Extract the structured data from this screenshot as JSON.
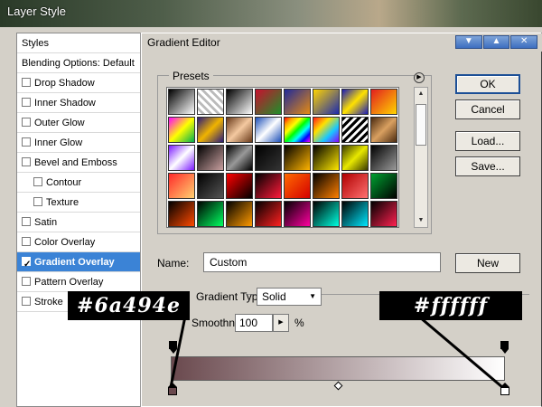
{
  "layer_style": {
    "title": "Layer Style",
    "styles_header": "Styles",
    "blending": "Blending Options: Default",
    "items": [
      {
        "label": "Drop Shadow",
        "checked": false,
        "indent": false,
        "selected": false
      },
      {
        "label": "Inner Shadow",
        "checked": false,
        "indent": false,
        "selected": false
      },
      {
        "label": "Outer Glow",
        "checked": false,
        "indent": false,
        "selected": false
      },
      {
        "label": "Inner Glow",
        "checked": false,
        "indent": false,
        "selected": false
      },
      {
        "label": "Bevel and Emboss",
        "checked": false,
        "indent": false,
        "selected": false
      },
      {
        "label": "Contour",
        "checked": false,
        "indent": true,
        "selected": false
      },
      {
        "label": "Texture",
        "checked": false,
        "indent": true,
        "selected": false
      },
      {
        "label": "Satin",
        "checked": false,
        "indent": false,
        "selected": false
      },
      {
        "label": "Color Overlay",
        "checked": false,
        "indent": false,
        "selected": false
      },
      {
        "label": "Gradient Overlay",
        "checked": true,
        "indent": false,
        "selected": true
      },
      {
        "label": "Pattern Overlay",
        "checked": false,
        "indent": false,
        "selected": false
      },
      {
        "label": "Stroke",
        "checked": false,
        "indent": false,
        "selected": false
      }
    ]
  },
  "gradient_editor": {
    "title": "Gradient Editor",
    "window_buttons": [
      "▼",
      "▲",
      "✕"
    ],
    "presets_label": "Presets",
    "menu_arrow": "▶",
    "buttons": {
      "ok": "OK",
      "cancel": "Cancel",
      "load": "Load...",
      "save": "Save...",
      "new": "New"
    },
    "name_label": "Name:",
    "name_value": "Custom",
    "gradient_type_label": "Gradient Type:",
    "gradient_type_value": "Solid",
    "smoothness_label": "Smoothness:",
    "smoothness_value": "100",
    "percent": "%",
    "start_color": "#6a494e",
    "end_color": "#ffffff",
    "swatches": [
      "linear-gradient(135deg,#000,#fff)",
      "repeating-linear-gradient(45deg,#fff 0 3px,#bbb 3px 6px)",
      "linear-gradient(135deg,#000,#fff)",
      "linear-gradient(135deg,#c8102e,#1e8f2a)",
      "linear-gradient(135deg,#1f2a9a,#e58a13)",
      "linear-gradient(135deg,#ffd400,#1b2ab0)",
      "linear-gradient(135deg,#1a1ab8,#ffe200,#1a1ab8)",
      "linear-gradient(135deg,#e21f1f,#ffd400)",
      "linear-gradient(135deg,#ff00ff,#ffff00,#00b050)",
      "linear-gradient(135deg,#2a1a7a,#f0b400,#2a1a7a)",
      "linear-gradient(135deg,#6a3a1a,#f4c9a0,#6a3a1a)",
      "linear-gradient(135deg,#1c4fb8,#fff,#1c4fb8)",
      "linear-gradient(135deg,red,orange,yellow,lime,cyan,blue,magenta)",
      "linear-gradient(135deg,#ff1a1a,#ffe000,#18c8ff,#8b00ff)",
      "repeating-linear-gradient(135deg,#000 0 3px,#fff 3px 6px)",
      "linear-gradient(135deg,#4a2a10,#d9a060,#4a2a10)",
      "linear-gradient(135deg,#7a1aff,#fff,#7a1aff)",
      "linear-gradient(135deg,#000,#c9a0a0)",
      "linear-gradient(135deg,#000,#999,#000)",
      "linear-gradient(135deg,#000,#333)",
      "linear-gradient(135deg,#000,#ffb400)",
      "linear-gradient(135deg,#000,#ffe800)",
      "linear-gradient(135deg,#3a3a00,#e8e800,#3a3a00)",
      "linear-gradient(135deg,#000,#9a9a9a)",
      "linear-gradient(135deg,#ff2a2a,#ffd070)",
      "linear-gradient(135deg,#000,#555)",
      "linear-gradient(135deg,#ff0000,#000)",
      "linear-gradient(135deg,#000,#ff1a3a)",
      "linear-gradient(135deg,#ff6a00,#d40000)",
      "linear-gradient(135deg,#000,#ff8000)",
      "linear-gradient(135deg,#b00000,#ff7070)",
      "linear-gradient(135deg,#00a030,#000)",
      "linear-gradient(135deg,#000,#ff4a00)",
      "linear-gradient(135deg,#000,#00ff60)",
      "linear-gradient(135deg,#000,#ff9a00)",
      "linear-gradient(135deg,#000,#ff2020)",
      "linear-gradient(135deg,#000,#ff00a0)",
      "linear-gradient(135deg,#000,#00ffe0)",
      "linear-gradient(135deg,#000,#00e8ff)",
      "linear-gradient(135deg,#000,#ff2050)"
    ]
  },
  "annotations": {
    "left": "#6a494e",
    "right": "#ffffff"
  }
}
